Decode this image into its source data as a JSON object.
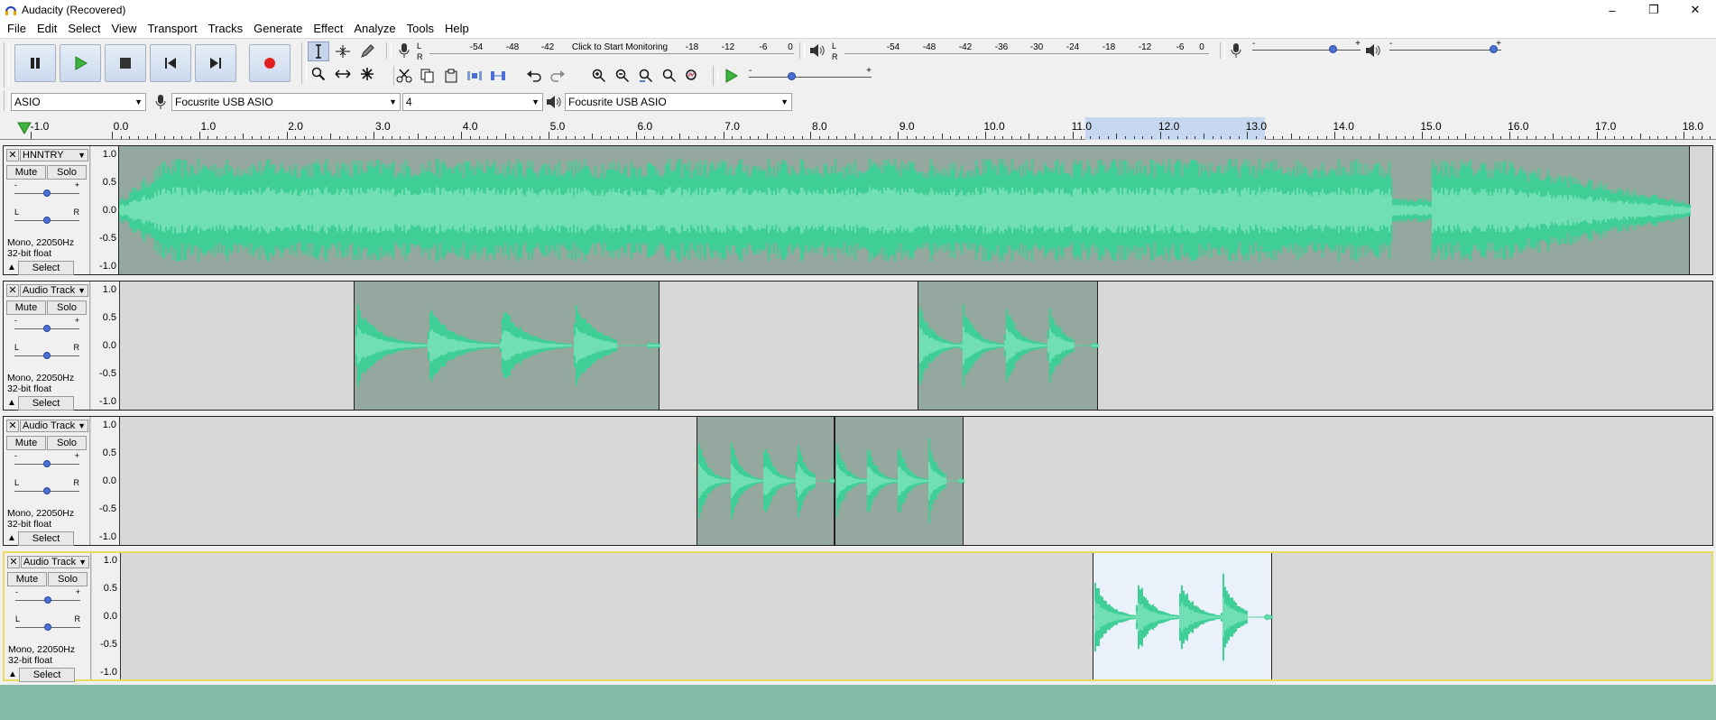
{
  "window": {
    "title": "Audacity (Recovered)"
  },
  "menu": [
    "File",
    "Edit",
    "Select",
    "View",
    "Transport",
    "Tracks",
    "Generate",
    "Effect",
    "Analyze",
    "Tools",
    "Help"
  ],
  "recording_meter": {
    "lr": [
      "L",
      "R"
    ],
    "scale": [
      "-54",
      "-48",
      "-42",
      "Click to Start Monitoring",
      "-18",
      "-12",
      "-6",
      "0"
    ]
  },
  "playback_meter": {
    "lr": [
      "L",
      "R"
    ],
    "scale": [
      "-54",
      "-48",
      "-42",
      "-36",
      "-30",
      "-24",
      "-18",
      "-12",
      "-6",
      "0"
    ]
  },
  "mixer": {
    "minus": "-",
    "plus": "+",
    "recording_level": 0.77,
    "playback_level": 0.97
  },
  "play_at_speed": {
    "minus": "-",
    "plus": "+",
    "level": 0.34
  },
  "devices": {
    "host": "ASIO",
    "recording_device": "Focusrite USB ASIO",
    "channels": "4",
    "playback_device": "Focusrite USB ASIO"
  },
  "ruler": {
    "labels": [
      "-1.0",
      "0.0",
      "1.0",
      "2.0",
      "3.0",
      "4.0",
      "5.0",
      "6.0",
      "7.0",
      "8.0",
      "9.0",
      "10.0",
      "11.0",
      "12.0",
      "13.0",
      "14.0",
      "15.0",
      "16.0",
      "17.0",
      "18.0"
    ],
    "selection_start": 11.15,
    "selection_end": 13.2
  },
  "colors": {
    "waveform": "#3fcf96",
    "waveform_rms": "#70e0b4",
    "clip_bg": "#95a8a0",
    "selected_clip_bg": "#eaf1fb",
    "track_bg": "#d8d8d8",
    "bottom": "#84bba6"
  },
  "tracks": [
    {
      "name": "HNNTRY",
      "mute": "Mute",
      "solo": "Solo",
      "gain_minus": "-",
      "gain_plus": "+",
      "pan_l": "L",
      "pan_r": "R",
      "info1": "Mono, 22050Hz",
      "info2": "32-bit float",
      "select": "Select",
      "scale": [
        "1.0",
        "0.5",
        "0.0",
        "-0.5",
        "-1.0"
      ],
      "clips": [
        {
          "start": 0.0,
          "end": 18.0,
          "selected": false,
          "style": "dense"
        }
      ]
    },
    {
      "name": "Audio Track",
      "mute": "Mute",
      "solo": "Solo",
      "gain_minus": "-",
      "gain_plus": "+",
      "pan_l": "L",
      "pan_r": "R",
      "info1": "Mono, 22050Hz",
      "info2": "32-bit float",
      "select": "Select",
      "scale": [
        "1.0",
        "0.5",
        "0.0",
        "-0.5",
        "-1.0"
      ],
      "clips": [
        {
          "start": 2.7,
          "end": 6.2,
          "selected": false,
          "style": "sparse"
        },
        {
          "start": 9.15,
          "end": 11.22,
          "selected": false,
          "style": "sparse"
        }
      ]
    },
    {
      "name": "Audio Track",
      "mute": "Mute",
      "solo": "Solo",
      "gain_minus": "-",
      "gain_plus": "+",
      "pan_l": "L",
      "pan_r": "R",
      "info1": "Mono, 22050Hz",
      "info2": "32-bit float",
      "select": "Select",
      "scale": [
        "1.0",
        "0.5",
        "0.0",
        "-0.5",
        "-1.0"
      ],
      "clips": [
        {
          "start": 6.62,
          "end": 8.2,
          "selected": false,
          "style": "sparse"
        },
        {
          "start": 8.2,
          "end": 9.68,
          "selected": false,
          "style": "sparse"
        }
      ]
    },
    {
      "name": "Audio Track",
      "mute": "Mute",
      "solo": "Solo",
      "gain_minus": "-",
      "gain_plus": "+",
      "pan_l": "L",
      "pan_r": "R",
      "info1": "Mono, 22050Hz",
      "info2": "32-bit float",
      "select": "Select",
      "scale": [
        "1.0",
        "0.5",
        "0.0",
        "-0.5",
        "-1.0"
      ],
      "clips": [
        {
          "start": 11.15,
          "end": 13.2,
          "selected": true,
          "style": "sparse"
        }
      ]
    }
  ]
}
